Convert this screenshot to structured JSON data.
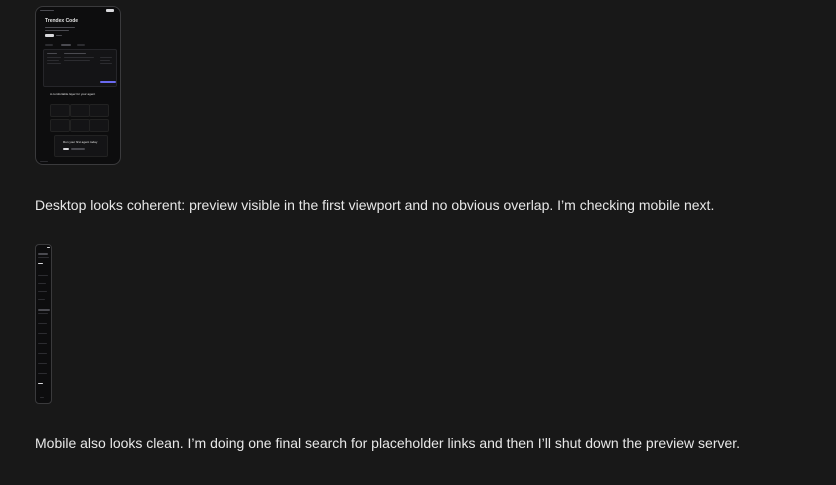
{
  "desktop_preview": {
    "nav_label": "",
    "hero_title": "Trendex Code",
    "section_title": "A comfortable layer for your agent",
    "cta_title": "Run your first agent today"
  },
  "mobile_preview": {
    "hero_title": "Trendex Code",
    "section_title": "A comfortable layer"
  },
  "messages": [
    "Desktop looks coherent: preview visible in the first viewport and no obvious overlap. I’m checking mobile next.",
    "Mobile also looks clean. I’m doing one final search for placeholder links and then I’ll shut down the preview server."
  ]
}
